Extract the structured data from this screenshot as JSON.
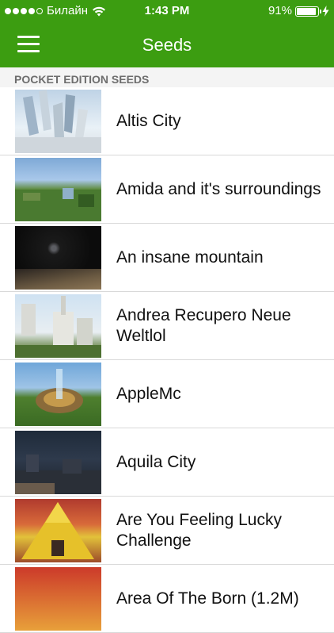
{
  "status_bar": {
    "carrier": "Билайн",
    "time": "1:43 PM",
    "battery_percent": "91%",
    "battery_level": 0.91,
    "signal_bars_filled": 4,
    "signal_bars_total": 5
  },
  "nav": {
    "title": "Seeds",
    "menu_icon": "hamburger-menu-icon"
  },
  "section": {
    "title": "POCKET EDITION SEEDS"
  },
  "seeds": [
    {
      "label": "Altis City"
    },
    {
      "label": "Amida and it's surroundings"
    },
    {
      "label": "An insane mountain"
    },
    {
      "label": "Andrea Recupero Neue Weltlol"
    },
    {
      "label": "AppleMc"
    },
    {
      "label": "Aquila City"
    },
    {
      "label": "Are You Feeling Lucky Challenge"
    },
    {
      "label": "Area Of The Born (1.2M)"
    }
  ],
  "colors": {
    "header_green": "#3c9d11",
    "section_bg": "#f4f4f4",
    "section_text": "#6d6d6d"
  }
}
